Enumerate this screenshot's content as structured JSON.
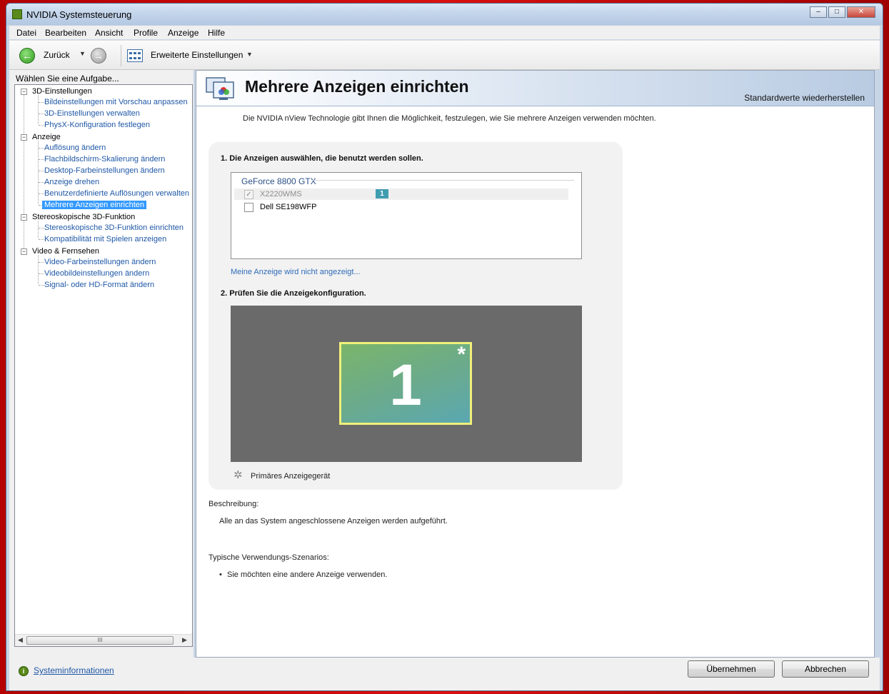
{
  "window": {
    "title": "NVIDIA Systemsteuerung",
    "controls": {
      "minimize": "–",
      "maximize": "□",
      "close": "✕"
    }
  },
  "menubar": [
    "Datei",
    "Bearbeiten",
    "Ansicht",
    "Profile",
    "Anzeige",
    "Hilfe"
  ],
  "toolbar": {
    "back_label": "Zurück",
    "advanced_settings_label": "Erweiterte Einstellungen",
    "icons": {
      "back": "arrow-left-icon",
      "forward": "arrow-right-icon",
      "settings": "grid-icon"
    }
  },
  "sidebar": {
    "heading": "Wählen Sie eine Aufgabe...",
    "groups": [
      {
        "label": "3D-Einstellungen",
        "items": [
          "Bildeinstellungen mit Vorschau anpassen",
          "3D-Einstellungen verwalten",
          "PhysX-Konfiguration festlegen"
        ]
      },
      {
        "label": "Anzeige",
        "items": [
          "Auflösung ändern",
          "Flachbildschirm-Skalierung ändern",
          "Desktop-Farbeinstellungen ändern",
          "Anzeige drehen",
          "Benutzerdefinierte Auflösungen verwalten",
          "Mehrere Anzeigen einrichten"
        ]
      },
      {
        "label": "Stereoskopische 3D-Funktion",
        "items": [
          "Stereoskopische 3D-Funktion einrichten",
          "Kompatibilität mit Spielen anzeigen"
        ]
      },
      {
        "label": "Video & Fernsehen",
        "items": [
          "Video-Farbeinstellungen ändern",
          "Videobildeinstellungen ändern",
          "Signal- oder HD-Format ändern"
        ]
      }
    ],
    "selected_item": "Mehrere Anzeigen einrichten",
    "scroll_thumb_label": "III",
    "sysinfo_label": "Systeminformationen"
  },
  "content": {
    "title": "Mehrere Anzeigen einrichten",
    "restore_defaults": "Standardwerte wiederherstellen",
    "description": "Die NVIDIA nView Technologie gibt Ihnen die Möglichkeit, festzulegen, wie Sie mehrere Anzeigen verwenden möchten.",
    "step1_heading": "1. Die Anzeigen auswählen, die benutzt werden sollen.",
    "gpu_name": "GeForce 8800 GTX",
    "displays": [
      {
        "name": "X2220WMS",
        "checked": true,
        "disabled": true,
        "badge": "1"
      },
      {
        "name": "Dell SE198WFP",
        "checked": false,
        "disabled": false,
        "badge": ""
      }
    ],
    "missing_display_link": "Meine Anzeige wird nicht angezeigt...",
    "step2_heading": "2. Prüfen Sie die Anzeigekonfiguration.",
    "preview": {
      "monitor_number": "1",
      "primary_marker": "*"
    },
    "legend_label": "Primäres Anzeigegerät",
    "description_heading": "Beschreibung:",
    "description_text": "Alle an das System angeschlossene Anzeigen werden aufgeführt.",
    "scenarios_heading": "Typische Verwendungs-Szenarios:",
    "scenarios": [
      "Sie möchten eine andere Anzeige verwenden."
    ]
  },
  "buttons": {
    "apply": "Übernehmen",
    "cancel": "Abbrechen"
  },
  "colors": {
    "link": "#1f58a6",
    "selection": "#3399ff",
    "monitor_border": "#f0f07a",
    "preview_bg": "#6a6a6a"
  }
}
